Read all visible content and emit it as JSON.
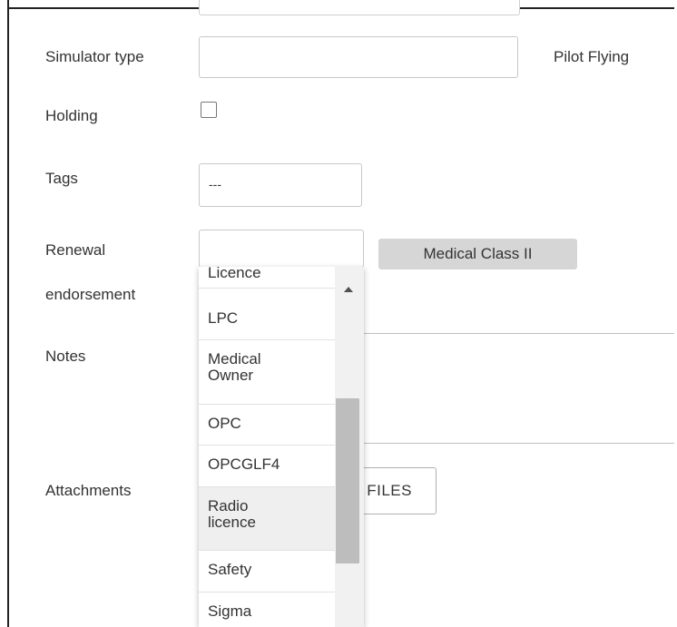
{
  "form": {
    "simulator_type_label": "Simulator type",
    "simulator_type_value": "",
    "pilot_flying_label": "Pilot Flying",
    "holding_label": "Holding",
    "holding_checked": false,
    "tags_label": "Tags",
    "tags_value": "---",
    "renewal_label_line1": "Renewal",
    "renewal_label_line2": "endorsement",
    "renewal_value": "",
    "renewal_selected_chip": "Medical Class II",
    "notes_label": "Notes",
    "attachments_label": "Attachments",
    "files_button_label": "FILES"
  },
  "dropdown": {
    "items": [
      {
        "line1": "Licence",
        "line2": ""
      },
      {
        "line1": "LPC",
        "line2": ""
      },
      {
        "line1": "Medical",
        "line2": "Owner"
      },
      {
        "line1": "OPC",
        "line2": ""
      },
      {
        "line1": "OPCGLF4",
        "line2": ""
      },
      {
        "line1": "Radio",
        "line2": "licence"
      },
      {
        "line1": "Safety",
        "line2": ""
      },
      {
        "line1": "Sigma",
        "line2": ""
      }
    ],
    "highlighted_index": 5
  },
  "icons": {
    "scroll_up": "scroll-up-arrow-icon"
  }
}
